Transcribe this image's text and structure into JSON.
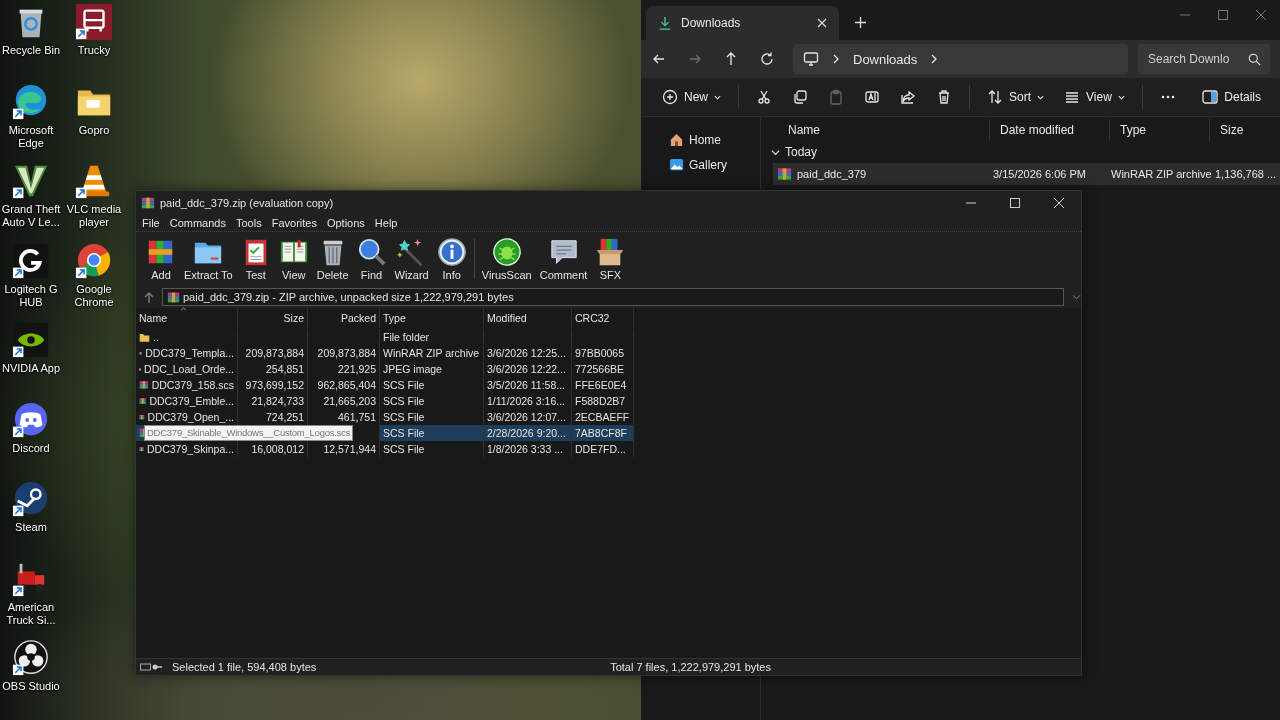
{
  "desktop_icons": [
    {
      "label": "Recycle Bin",
      "kind": "bin"
    },
    {
      "label": "Microsoft Edge",
      "kind": "edge"
    },
    {
      "label": "Grand Theft Auto V Le...",
      "kind": "vlogo"
    },
    {
      "label": "Logitech G HUB",
      "kind": "glogo"
    },
    {
      "label": "NVIDIA App",
      "kind": "eye"
    },
    {
      "label": "Discord",
      "kind": "controller"
    },
    {
      "label": "Steam",
      "kind": "piston"
    },
    {
      "label": "American Truck Si...",
      "kind": "redtruck"
    },
    {
      "label": "OBS Studio",
      "kind": "rings"
    },
    {
      "label": "Trucky",
      "kind": "truck"
    },
    {
      "label": "Gopro",
      "kind": "folder"
    },
    {
      "label": "VLC media player",
      "kind": "cone"
    },
    {
      "label": "Google Chrome",
      "kind": "tricolor"
    }
  ],
  "explorer": {
    "tab": {
      "label": "Downloads",
      "selected": true
    },
    "nav": [
      {
        "kind": "back",
        "disabled": false
      },
      {
        "kind": "forward",
        "disabled": true
      },
      {
        "kind": "up",
        "disabled": false
      },
      {
        "kind": "refresh",
        "disabled": false
      }
    ],
    "breadcrumb": [
      "Downloads"
    ],
    "search": {
      "placeholder": "Search Downlo"
    },
    "toolbar": [
      {
        "kind": "new",
        "label": "New",
        "disabled": false
      },
      {
        "kind": "cut",
        "disabled": false
      },
      {
        "kind": "copy",
        "disabled": false
      },
      {
        "kind": "paste",
        "disabled": true
      },
      {
        "kind": "rename",
        "disabled": false
      },
      {
        "kind": "share",
        "disabled": false
      },
      {
        "kind": "delete",
        "disabled": false
      },
      {
        "kind": "sort",
        "label": "Sort",
        "disabled": false
      },
      {
        "kind": "view",
        "label": "View",
        "disabled": false
      },
      {
        "kind": "more",
        "disabled": false
      }
    ],
    "details": {
      "label": "Details"
    },
    "sidebar": [
      {
        "label": "Home",
        "kind": "home"
      },
      {
        "label": "Gallery",
        "kind": "gallery"
      }
    ],
    "columns": [
      "Name",
      "Date modified",
      "Type",
      "Size"
    ],
    "groups": [
      {
        "label": "Today",
        "expanded": true,
        "rows": [
          {
            "name": "paid_ddc_379",
            "modified": "3/15/2026 6:06 PM",
            "type": "WinRAR ZIP archive",
            "size": "1,136,768 ...",
            "selected": true
          }
        ]
      }
    ]
  },
  "winrar": {
    "title": "paid_ddc_379.zip (evaluation copy)",
    "menu": [
      "File",
      "Commands",
      "Tools",
      "Favorites",
      "Options",
      "Help"
    ],
    "toolbar": [
      {
        "label": "Add",
        "kind": "add"
      },
      {
        "label": "Extract To",
        "kind": "extract"
      },
      {
        "label": "Test",
        "kind": "test"
      },
      {
        "label": "View",
        "kind": "view"
      },
      {
        "label": "Delete",
        "kind": "delete"
      },
      {
        "label": "Find",
        "kind": "find"
      },
      {
        "label": "Wizard",
        "kind": "wizard"
      },
      {
        "label": "Info",
        "kind": "info"
      },
      {
        "label": "VirusScan",
        "kind": "virus"
      },
      {
        "label": "Comment",
        "kind": "comment"
      },
      {
        "label": "SFX",
        "kind": "sfx"
      }
    ],
    "path": "paid_ddc_379.zip - ZIP archive, unpacked size 1,222,979,291 bytes",
    "columns": [
      "Name",
      "Size",
      "Packed",
      "Type",
      "Modified",
      "CRC32"
    ],
    "rows": [
      {
        "kind": "folder",
        "name": "..",
        "type": "File folder",
        "selected": false,
        "tooltip": false
      },
      {
        "kind": "archive",
        "name": "DDC379_Templa...",
        "size": "209,873,884",
        "packed": "209,873,884",
        "type": "WinRAR ZIP archive",
        "modified": "3/6/2026 12:25...",
        "crc": "97BB0065",
        "selected": false,
        "tooltip": false
      },
      {
        "kind": "image",
        "name": "DDC_Load_Orde...",
        "size": "254,851",
        "packed": "221,925",
        "type": "JPEG image",
        "modified": "3/6/2026 12:22...",
        "crc": "772566BE",
        "selected": false,
        "tooltip": false
      },
      {
        "kind": "archive",
        "name": "DDC379_158.scs",
        "size": "973,699,152",
        "packed": "962,865,404",
        "type": "SCS File",
        "modified": "3/5/2026 11:58...",
        "crc": "FFE6E0E4",
        "selected": false,
        "tooltip": false
      },
      {
        "kind": "archive",
        "name": "DDC379_Emble...",
        "size": "21,824,733",
        "packed": "21,665,203",
        "type": "SCS File",
        "modified": "1/11/2026 3:16...",
        "crc": "F588D2B7",
        "selected": false,
        "tooltip": false
      },
      {
        "kind": "archive",
        "name": "DDC379_Open_...",
        "size": "724,251",
        "packed": "461,751",
        "type": "SCS File",
        "modified": "3/6/2026 12:07...",
        "crc": "2ECBAEFF",
        "selected": false,
        "tooltip": false
      },
      {
        "kind": "archive",
        "name": "DDC379_Skinable_Windows__Custom_Logos.scs",
        "type": "SCS File",
        "modified": "2/28/2026 9:20...",
        "crc": "7AB8CF8F",
        "selected": true,
        "tooltip": true
      },
      {
        "kind": "archive",
        "name": "DDC379_Skinpa...",
        "size": "16,008,012",
        "packed": "12,571,944",
        "type": "SCS File",
        "modified": "1/8/2026 3:33 ...",
        "crc": "DDE7FD...",
        "selected": false,
        "tooltip": false
      }
    ],
    "status": {
      "selected": "Selected 1 file, 594,408 bytes",
      "total": "Total 7 files, 1,222,979,291 bytes"
    }
  }
}
